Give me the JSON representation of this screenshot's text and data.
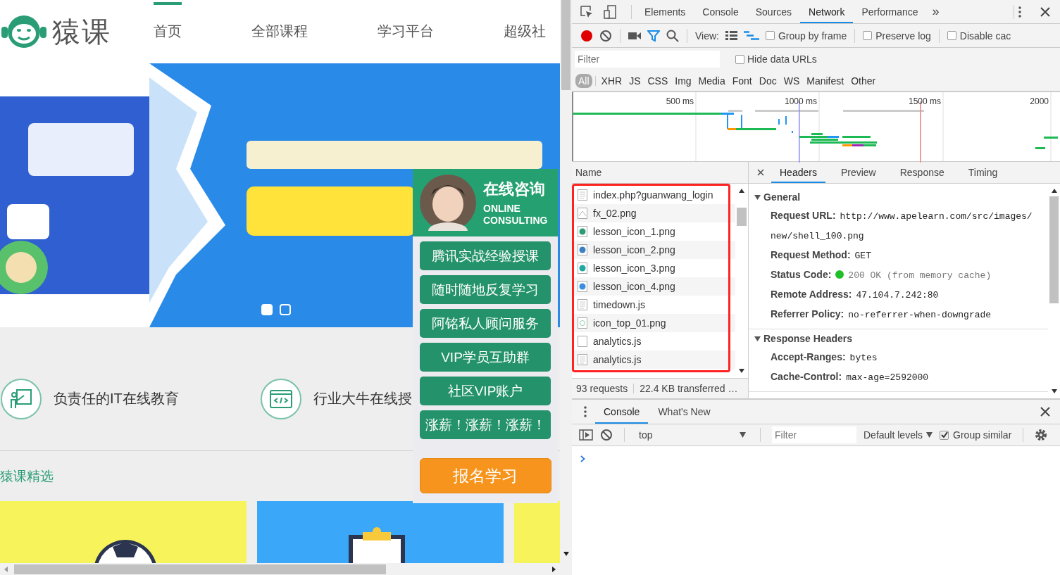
{
  "site": {
    "logo": "猿课",
    "nav": [
      {
        "label": "首页",
        "selected": true
      },
      {
        "label": "全部课程",
        "selected": false
      },
      {
        "label": "学习平台",
        "selected": false
      },
      {
        "label": "超级社",
        "selected": false
      }
    ],
    "banner": {
      "kind": "picture",
      "dots": [
        {
          "selected": true
        },
        {
          "selected": false
        }
      ]
    },
    "consult": {
      "title": "在线咨询",
      "subtitle": [
        "ONLINE",
        "CONSULTING"
      ],
      "links": [
        "腾讯实战经验授课",
        "随时随地反复学习",
        "阿铭私人顾问服务",
        "VIP学员互助群",
        "社区VIP账户",
        "涨薪！涨薪！涨薪！"
      ],
      "cta": "报名学习"
    },
    "features": [
      {
        "kind": "teach",
        "text": "负责任的IT在线教育"
      },
      {
        "kind": "code",
        "text": "行业大牛在线授"
      }
    ],
    "section_title": "猿课精选",
    "courses": [
      {
        "kind": "ball",
        "color": "#f7f35a"
      },
      {
        "kind": "board",
        "color": "#3ba7f8"
      },
      {
        "kind": "blank",
        "color": "#f7f35a"
      }
    ]
  },
  "devtools": {
    "tabs": [
      {
        "label": "Elements",
        "selected": false
      },
      {
        "label": "Console",
        "selected": false
      },
      {
        "label": "Sources",
        "selected": false
      },
      {
        "label": "Network",
        "selected": true
      },
      {
        "label": "Performance",
        "selected": false
      }
    ],
    "more": "»",
    "view_label": "View:",
    "toolbar_checks": [
      {
        "label": "Group by frame",
        "checked": false
      },
      {
        "label": "Preserve log",
        "checked": false
      },
      {
        "label": "Disable cac",
        "checked": false
      }
    ],
    "filter": {
      "placeholder": "Filter"
    },
    "hide_data_urls": {
      "label": "Hide data URLs",
      "checked": false
    },
    "types": [
      {
        "label": "All",
        "selected": true
      },
      {
        "label": "XHR",
        "selected": false
      },
      {
        "label": "JS",
        "selected": false
      },
      {
        "label": "CSS",
        "selected": false
      },
      {
        "label": "Img",
        "selected": false
      },
      {
        "label": "Media",
        "selected": false
      },
      {
        "label": "Font",
        "selected": false
      },
      {
        "label": "Doc",
        "selected": false
      },
      {
        "label": "WS",
        "selected": false
      },
      {
        "label": "Manifest",
        "selected": false
      },
      {
        "label": "Other",
        "selected": false
      }
    ],
    "overview_ticks": [
      "500 ms",
      "1000 ms",
      "1500 ms",
      "2000"
    ],
    "name_header": "Name",
    "requests": [
      {
        "kind": "doc",
        "name": "index.php?guanwang_login"
      },
      {
        "name": "fx_02.png"
      },
      {
        "kind": "icon",
        "color": "#2a9d76",
        "name": "lesson_icon_1.png"
      },
      {
        "kind": "icon",
        "color": "#3b7fc4",
        "name": "lesson_icon_2.png"
      },
      {
        "kind": "icon",
        "color": "#1fa8a0",
        "name": "lesson_icon_3.png"
      },
      {
        "kind": "icon",
        "color": "#3a8de0",
        "name": "lesson_icon_4.png"
      },
      {
        "kind": "doc",
        "name": "timedown.js"
      },
      {
        "kind": "thumb",
        "name": "icon_top_01.png"
      },
      {
        "kind": "blank",
        "name": "analytics.js"
      },
      {
        "kind": "doc",
        "name": "analytics.js"
      }
    ],
    "summary": [
      "93 requests",
      "22.4 KB transferred …"
    ],
    "detail_tabs": [
      {
        "label": "Headers",
        "selected": true
      },
      {
        "label": "Preview",
        "selected": false
      },
      {
        "label": "Response",
        "selected": false
      },
      {
        "label": "Timing",
        "selected": false
      }
    ],
    "sections": [
      {
        "title": "General",
        "expanded": true,
        "rows": [
          {
            "kind": "text",
            "key": "Request URL:",
            "value": "http://www.apelearn.com/src/images/new/shell_100.png"
          },
          {
            "kind": "text",
            "key": "Request Method:",
            "value": "GET"
          },
          {
            "kind": "status",
            "key": "Status Code:",
            "value": "200 OK (from memory cache)"
          },
          {
            "kind": "text",
            "key": "Remote Address:",
            "value": "47.104.7.242:80"
          },
          {
            "kind": "text",
            "key": "Referrer Policy:",
            "value": "no-referrer-when-downgrade"
          }
        ]
      },
      {
        "title": "Response Headers",
        "expanded": true,
        "rows": [
          {
            "kind": "text",
            "key": "Accept-Ranges:",
            "value": "bytes"
          },
          {
            "kind": "text",
            "key": "Cache-Control:",
            "value": "max-age=2592000"
          }
        ]
      }
    ],
    "drawer": {
      "tabs": [
        {
          "label": "Console",
          "selected": true
        },
        {
          "label": "What's New",
          "selected": false
        }
      ],
      "context": "top",
      "filter": {
        "placeholder": "Filter"
      },
      "levels": "Default levels",
      "group_similar": {
        "label": "Group similar",
        "checked": true
      }
    }
  }
}
